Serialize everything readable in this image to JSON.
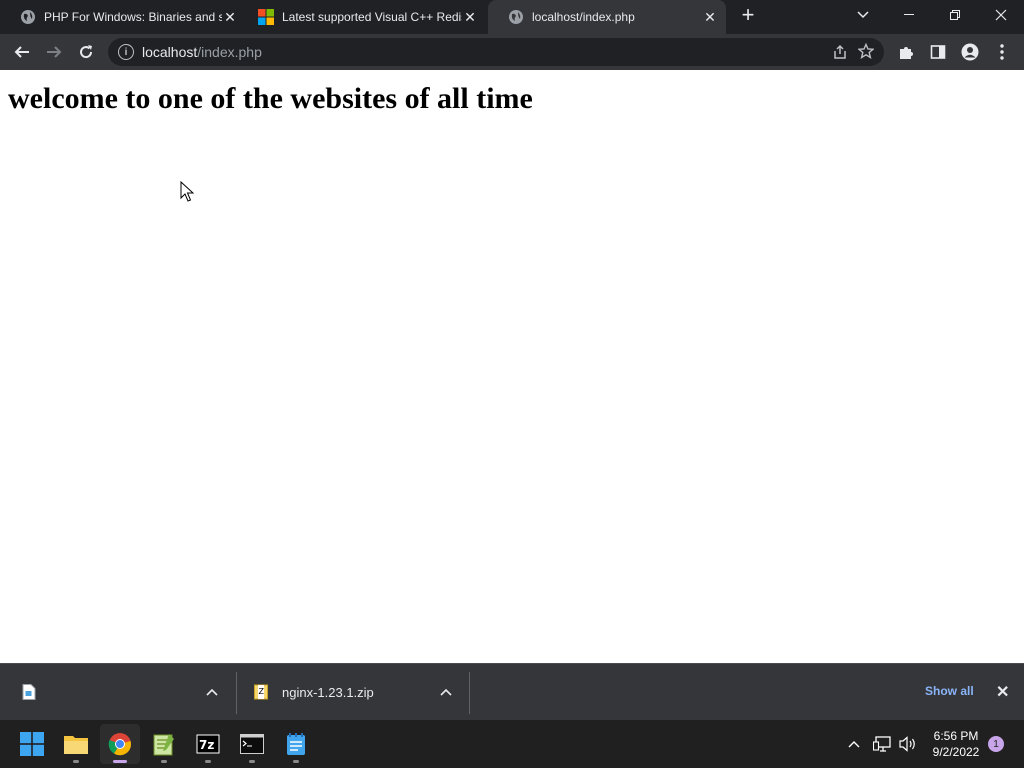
{
  "tabs": [
    {
      "title": "PHP For Windows: Binaries and source Releases",
      "favicon": "globe-icon",
      "active": false
    },
    {
      "title": "Latest supported Visual C++ Redistributable downloads",
      "favicon": "microsoft-logo-icon",
      "active": false
    },
    {
      "title": "localhost/index.php",
      "favicon": "globe-icon",
      "active": true
    }
  ],
  "omnibox": {
    "host": "localhost",
    "path": "/index.php"
  },
  "page": {
    "heading": "welcome to one of the websites of all time",
    "body_text": ""
  },
  "downloads": [
    {
      "filename": "",
      "icon": "image-file-icon"
    },
    {
      "filename": "nginx-1.23.1.zip",
      "icon": "zip-file-icon"
    }
  ],
  "download_bar": {
    "show_all": "Show all"
  },
  "taskbar": {
    "apps": [
      "start",
      "file-explorer",
      "chrome",
      "notepad-plus-plus",
      "7zip",
      "terminal",
      "notepad"
    ],
    "time": "6:56 PM",
    "date": "9/2/2022",
    "notification_count": "1"
  },
  "colors": {
    "accent_link": "#8ab4f8",
    "tab_strip": "#202124",
    "toolbar": "#35363a"
  }
}
